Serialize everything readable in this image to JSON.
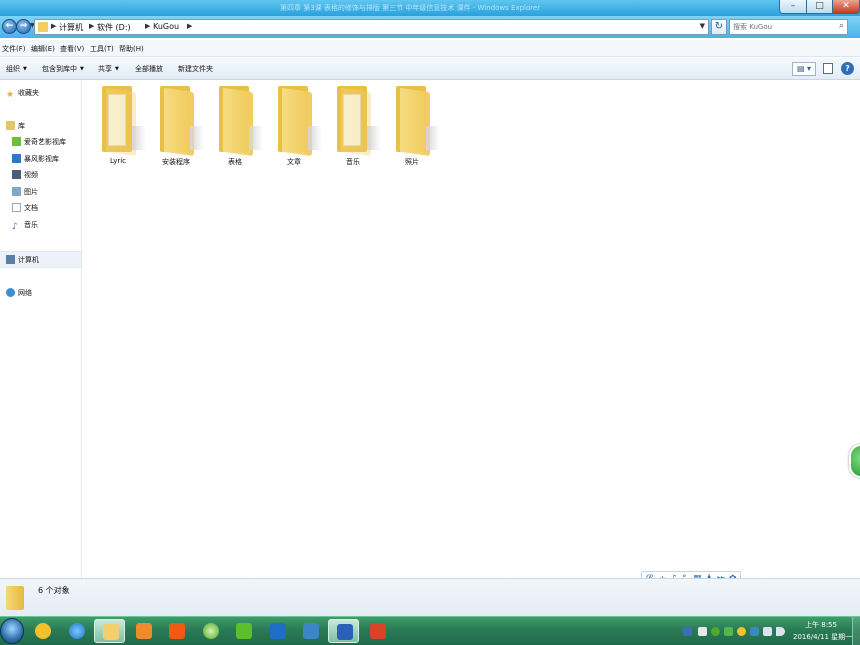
{
  "window": {
    "title_blurred": "第四章 第3课 表格的修饰与排版 第三节 中年级信息技术 课件 - Windows Explorer",
    "controls": {
      "minimize_icon": "minimize-icon",
      "maximize_icon": "maximize-icon",
      "close_icon": "close-icon"
    }
  },
  "nav": {
    "back_icon": "back-arrow-icon",
    "forward_icon": "forward-arrow-icon",
    "breadcrumb": [
      "计算机",
      "软件 (D:)",
      "KuGou"
    ],
    "refresh_icon": "refresh-icon",
    "search_placeholder": "搜索 KuGou"
  },
  "menu": [
    "文件(F)",
    "编辑(E)",
    "查看(V)",
    "工具(T)",
    "帮助(H)"
  ],
  "toolbar": {
    "organize": "组织",
    "include_in_library": "包含到库中",
    "share": "共享",
    "play_all": "全部播放",
    "new_folder": "新建文件夹"
  },
  "navpane": {
    "favorites": "收藏夹",
    "libraries": "库",
    "library_items": [
      "爱奇艺影视库",
      "暴风影视库",
      "视频",
      "图片",
      "文档",
      "音乐"
    ],
    "computer": "计算机",
    "network": "网络"
  },
  "folders": [
    "Lyric",
    "安装程序",
    "表格",
    "文章",
    "音乐",
    "照片"
  ],
  "status": {
    "item_count": "6 个对象"
  },
  "ime": [
    "中",
    "简"
  ],
  "taskbar": {
    "time": "上午 8:55",
    "date": "2016/4/11 星期一"
  },
  "colors": {
    "folder": "#f0c95a",
    "titlebar": "#2aa0dc",
    "taskbar": "#2b7a56"
  }
}
